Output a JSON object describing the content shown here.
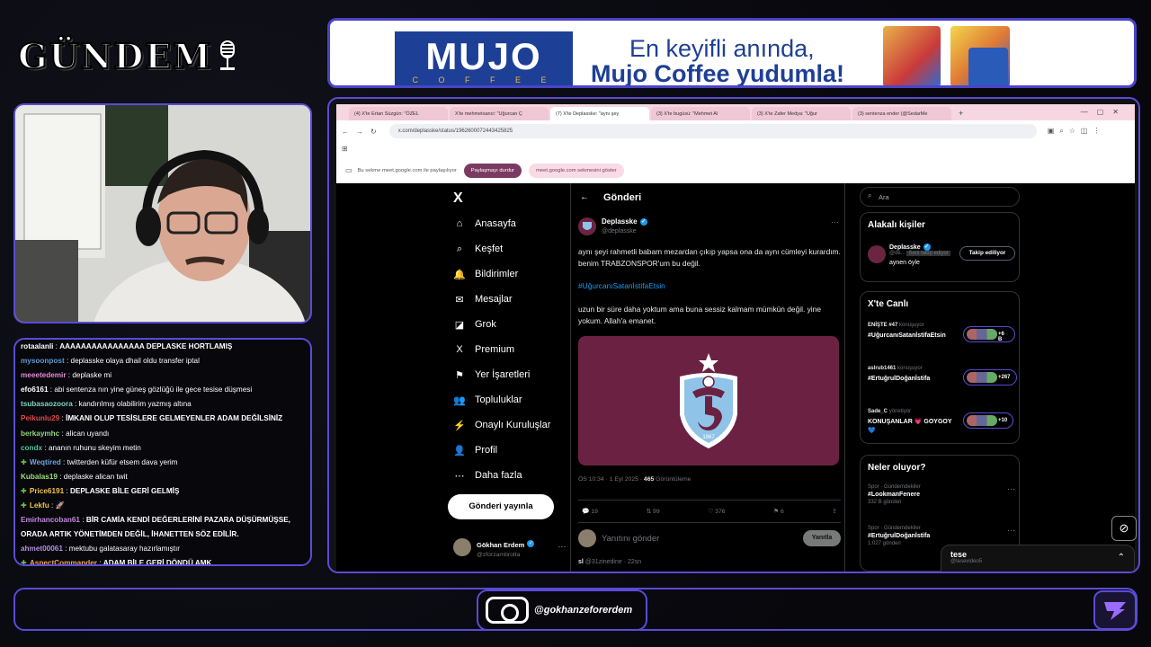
{
  "brand": {
    "title": "GÜNDEM",
    "accent": "#5a4bd6"
  },
  "ad": {
    "brand_big": "MUJO",
    "brand_small": "C O F F E E",
    "line1": "En keyifli anında,",
    "line2": "Mujo Coffee yudumla!"
  },
  "chat": [
    {
      "user": "rotaalanli",
      "color": "#ffffff",
      "msg": "AAAAAAAAAAAAAAAA DEPLASKE HORTLAMIŞ",
      "badge": false
    },
    {
      "user": "mysoonpost",
      "color": "#5b9bd5",
      "msg": "deplasske olaya dhail oldu transfer iptal",
      "badge": false
    },
    {
      "user": "meeetedemir",
      "color": "#e28bd3",
      "msg": "deplaske mi",
      "badge": false
    },
    {
      "user": "efo6161",
      "color": "#ffffff",
      "msg": "abi sentenza nın yine güneş gözlüğü ile gece tesise düşmesi",
      "badge": false
    },
    {
      "user": "tsubasaozoora",
      "color": "#7fd4c1",
      "msg": "kandırılmış olabilirim yazmış altına",
      "badge": false
    },
    {
      "user": "Peikunlu29",
      "color": "#e04848",
      "msg": "İMKANI OLUP TESİSLERE GELMEYENLER ADAM DEĞİLSİNİZ",
      "badge": false
    },
    {
      "user": "berkaymhc",
      "color": "#8fd47a",
      "msg": "alican uyandı",
      "badge": false
    },
    {
      "user": "condx",
      "color": "#4fc3a1",
      "msg": "ananın ruhunu skeyim metin",
      "badge": false
    },
    {
      "user": "Weqtired",
      "color": "#6fa3e0",
      "msg": "twitterden küfür etsem dava yerim",
      "badge": true
    },
    {
      "user": "Kubalas19",
      "color": "#9be07a",
      "msg": "deplaske alican twit",
      "badge": false
    },
    {
      "user": "Price6191",
      "color": "#f0c24a",
      "msg": "DEPLASKE BİLE GERİ GELMİŞ",
      "badge": true
    },
    {
      "user": "Lekfu",
      "color": "#f0c24a",
      "msg": "🚀",
      "badge": true
    },
    {
      "user": "Emirhancoban61",
      "color": "#c586e0",
      "msg": "BİR CAMİA KENDİ DEĞERLERİNİ PAZARA DÜŞÜRMÜŞSE,",
      "badge": false
    },
    {
      "user": "",
      "color": "#ffffff",
      "msg": "ORADA ARTIK YÖNETİMDEN DEĞİL, İHANETTEN SÖZ EDİLİR.",
      "badge": false
    },
    {
      "user": "ahmet00061",
      "color": "#b58fe0",
      "msg": "mektubu galatasaray hazırlamıştır",
      "badge": false
    },
    {
      "user": "AspectCommander",
      "color": "#f0a84a",
      "msg": "ADAM BİLE GERİ DÖNDÜ AMK",
      "badge": true
    }
  ],
  "browser": {
    "tabs": [
      "(4) X'te Ertan Süzgün: \"ÖZEL",
      "X'te mehmetsanci: \"Uğurcan Ç",
      "(7) X'te Deplasske: \"aynı şey",
      "(3) X'te bugüsü: \"Mehmet Al",
      "(3) X'te Zafer Medya: \"Uğur",
      "(3) sentenza ender (@SedarMe"
    ],
    "url": "x.com/deplasske/status/1962600072443425825",
    "share_text": "Bu sekme meet.google.com ile paylaşılıyor",
    "stop_share": "Paylaşmayı durdur",
    "show_tab": "meet.google.com sekmesini göster"
  },
  "xnav": [
    {
      "icon": "⌂",
      "label": "Anasayfa"
    },
    {
      "icon": "⌕",
      "label": "Keşfet"
    },
    {
      "icon": "🔔",
      "label": "Bildirimler"
    },
    {
      "icon": "✉",
      "label": "Mesajlar"
    },
    {
      "icon": "◪",
      "label": "Grok"
    },
    {
      "icon": "X",
      "label": "Premium"
    },
    {
      "icon": "⚑",
      "label": "Yer İşaretleri"
    },
    {
      "icon": "👥",
      "label": "Topluluklar"
    },
    {
      "icon": "⚡",
      "label": "Onaylı Kuruluşlar"
    },
    {
      "icon": "👤",
      "label": "Profil"
    },
    {
      "icon": "⋯",
      "label": "Daha fazla"
    }
  ],
  "post_button": "Gönderi yayınla",
  "me": {
    "name": "Gökhan Erdem",
    "handle": "@zforzambrotta"
  },
  "tweet": {
    "header": "Gönderi",
    "name": "Deplasske",
    "handle": "@deplasske",
    "text1": "aynı şeyi rahmetli babam mezardan çıkıp yapsa ona da aynı cümleyi kurardım. benim TRABZONSPOR'um bu değil.",
    "hashtag": "#UğurcanıSatanİstifaEtsin",
    "text2": "uzun bir süre daha yoktum ama buna sessiz kalmam mümkün değil. yine yokum. Allah'a emanet.",
    "time": "ÖS 10:34 · 1 Eyl 2025 ·",
    "views": "465",
    "views_label": "Görüntüleme",
    "replies": "19",
    "retweets": "99",
    "likes": "376",
    "bookmarks": "6",
    "reply_placeholder": "Yanıtını gönder",
    "reply_button": "Yanıtla",
    "next_user": "sl",
    "next_handle": "@31zinedine · 22sn",
    "crest_year": "1967"
  },
  "right": {
    "search": "Ara",
    "people_title": "Alakalı kişiler",
    "person_name": "Deplasske",
    "person_handle": "@de...",
    "person_badge": "Seni takip ediyor",
    "person_bio": "aynen öyle",
    "follow_btn": "Takip ediliyor",
    "live_title": "X'te Canlı",
    "live": [
      {
        "host": "ENİŞTE #47",
        "status": "konuşuyor",
        "title": "#UğurcanıSatanİstifaEtsin",
        "count": "+6 B"
      },
      {
        "host": "aslrub1461",
        "status": "konuşuyor",
        "title": "#ErtuğrulDoğanİstifa",
        "count": "+267"
      },
      {
        "host": "Sade_C",
        "status": "yönetiyor",
        "title": "KONUŞANLAR 💗 GOYGOY 💙",
        "count": "+10"
      }
    ],
    "trends_title": "Neler oluyor?",
    "trends": [
      {
        "cat": "Spor · Gündemdekiler",
        "tag": "#LookmanFenere",
        "count": "332 B gönderi"
      },
      {
        "cat": "Spor · Gündemdekiler",
        "tag": "#ErtuğrulDoğanİstifa",
        "count": "1.027 gönderi"
      }
    ]
  },
  "dm": {
    "name": "tese",
    "handle": "@tesevideo5"
  },
  "footer": {
    "instagram": "@gokhanzeforerdem"
  }
}
